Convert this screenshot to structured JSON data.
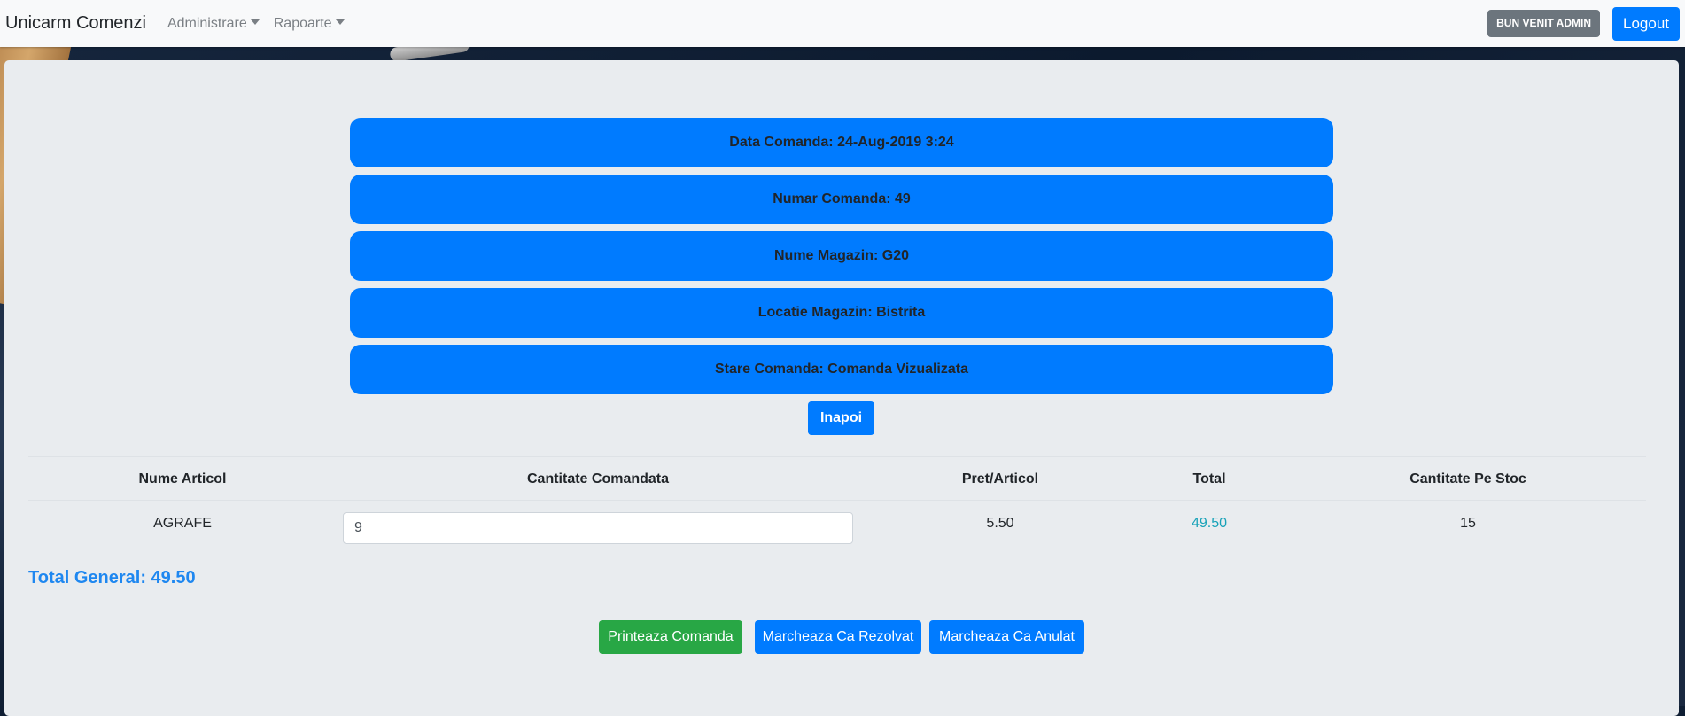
{
  "navbar": {
    "brand": "Unicarm Comenzi",
    "menu": [
      {
        "label": "Administrare"
      },
      {
        "label": "Rapoarte"
      }
    ],
    "welcome": "BUN VENIT ADMIN",
    "logout": "Logout"
  },
  "order_info": [
    {
      "text": "Data Comanda: 24-Aug-2019 3:24"
    },
    {
      "text": "Numar Comanda: 49"
    },
    {
      "text": "Nume Magazin: G20"
    },
    {
      "text": "Locatie Magazin: Bistrita"
    },
    {
      "text": "Stare Comanda: Comanda Vizualizata"
    }
  ],
  "back_button": "Inapoi",
  "table": {
    "headers": [
      "Nume Articol",
      "Cantitate Comandata",
      "Pret/Articol",
      "Total",
      "Cantitate Pe Stoc"
    ],
    "rows": [
      {
        "name": "AGRAFE",
        "quantity": "9",
        "price": "5.50",
        "total": "49.50",
        "stock": "15"
      }
    ]
  },
  "grand_total": "Total General: 49.50",
  "actions": {
    "print": "Printeaza Comanda",
    "resolved": "Marcheaza Ca Rezolvat",
    "cancelled": "Marcheaza Ca Anulat"
  },
  "colors": {
    "primary": "#007bff",
    "success": "#28a745",
    "secondary": "#6c757d",
    "info": "#17a2b8"
  }
}
